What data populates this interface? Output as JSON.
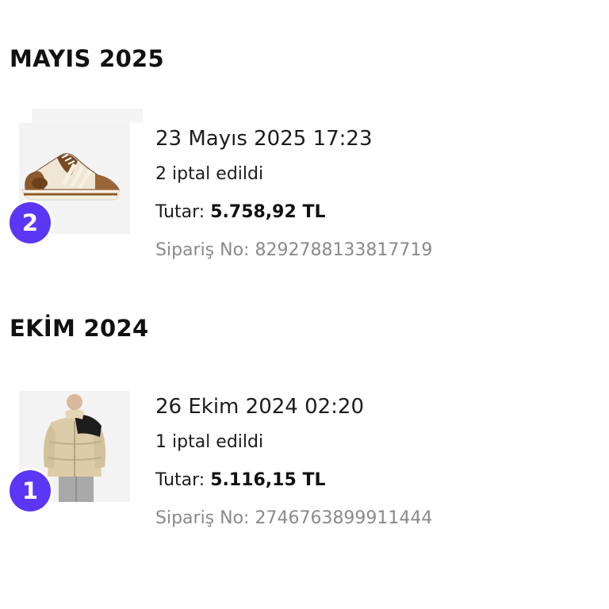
{
  "groups": [
    {
      "month": "MAYIS 2025",
      "order": {
        "date": "23 Mayıs 2025 17:23",
        "status": "2 iptal edildi",
        "total_label": "Tutar:",
        "total_value": "5.758,92 TL",
        "order_no": "Sipariş No: 8292788133817719",
        "item_count": "2",
        "thumbnail": "sneaker-image"
      }
    },
    {
      "month": "EKİM 2024",
      "order": {
        "date": "26 Ekim 2024 02:20",
        "status": "1 iptal edildi",
        "total_label": "Tutar:",
        "total_value": "5.116,15 TL",
        "order_no": "Sipariş No: 2746763899911444",
        "item_count": "1",
        "thumbnail": "puffer-jacket-image"
      }
    }
  ],
  "colors": {
    "badge": "#5b36f5",
    "muted_text": "#8a8a8a",
    "text": "#1c1c1c"
  }
}
